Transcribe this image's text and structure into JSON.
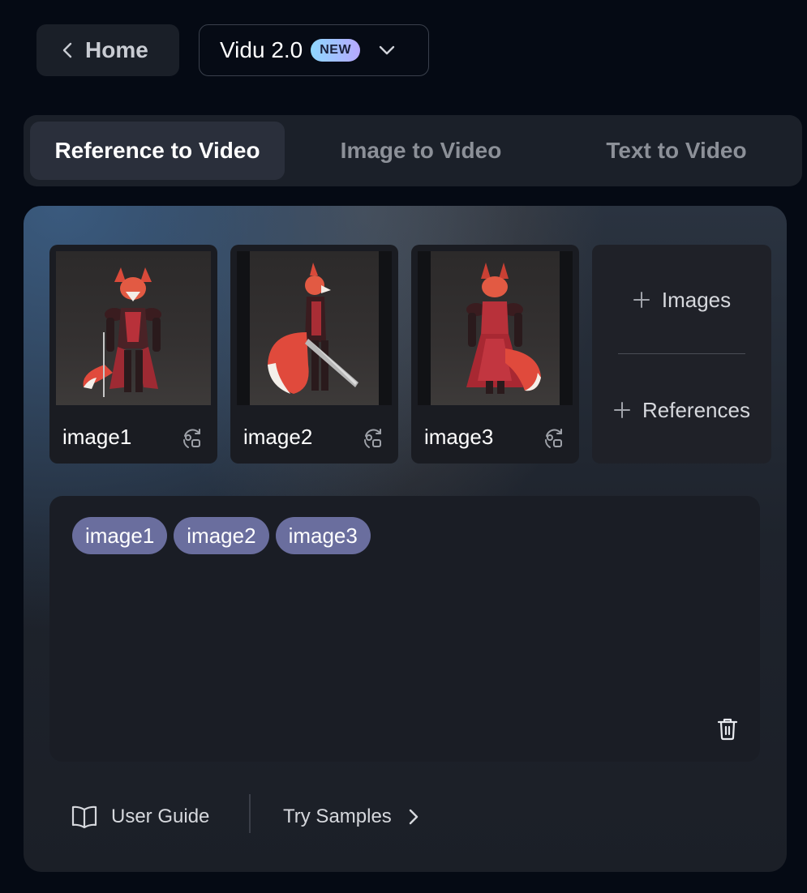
{
  "header": {
    "home_label": "Home",
    "model_name": "Vidu 2.0",
    "model_badge": "NEW"
  },
  "tabs": [
    {
      "label": "Reference to Video",
      "active": true
    },
    {
      "label": "Image to Video",
      "active": false
    },
    {
      "label": "Text to Video",
      "active": false
    }
  ],
  "references": {
    "cards": [
      {
        "label": "image1"
      },
      {
        "label": "image2"
      },
      {
        "label": "image3"
      }
    ],
    "add_images_label": "Images",
    "add_references_label": "References"
  },
  "prompt": {
    "chips": [
      "image1",
      "image2",
      "image3"
    ]
  },
  "footer": {
    "guide_label": "User Guide",
    "samples_label": "Try Samples"
  },
  "colors": {
    "background": "#050a14",
    "chip": "#6a6e9e",
    "badge_gradient_start": "#8fd8ff",
    "badge_gradient_end": "#b6a8ff"
  }
}
